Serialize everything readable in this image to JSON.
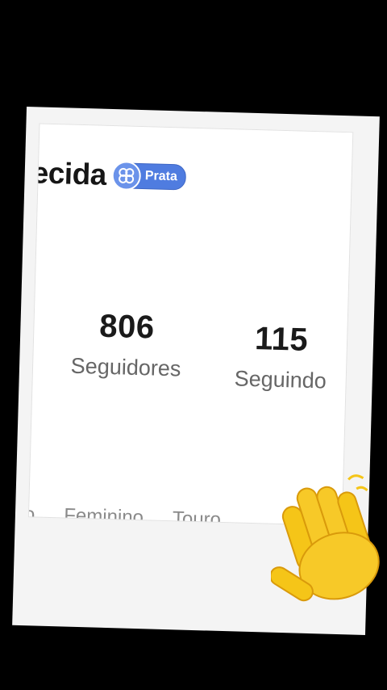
{
  "profile": {
    "name_visible": "ecida",
    "badge": {
      "label": "Prata",
      "icon": "ranking-badge-icon",
      "color": "#4f7ce0"
    }
  },
  "stats": {
    "followers": {
      "value": "806",
      "label": "Seguidores"
    },
    "following": {
      "value": "115",
      "label": "Seguindo"
    }
  },
  "tags": [
    "o",
    "Feminino",
    "Touro"
  ],
  "decorations": {
    "hand": "waving-hand-icon"
  }
}
